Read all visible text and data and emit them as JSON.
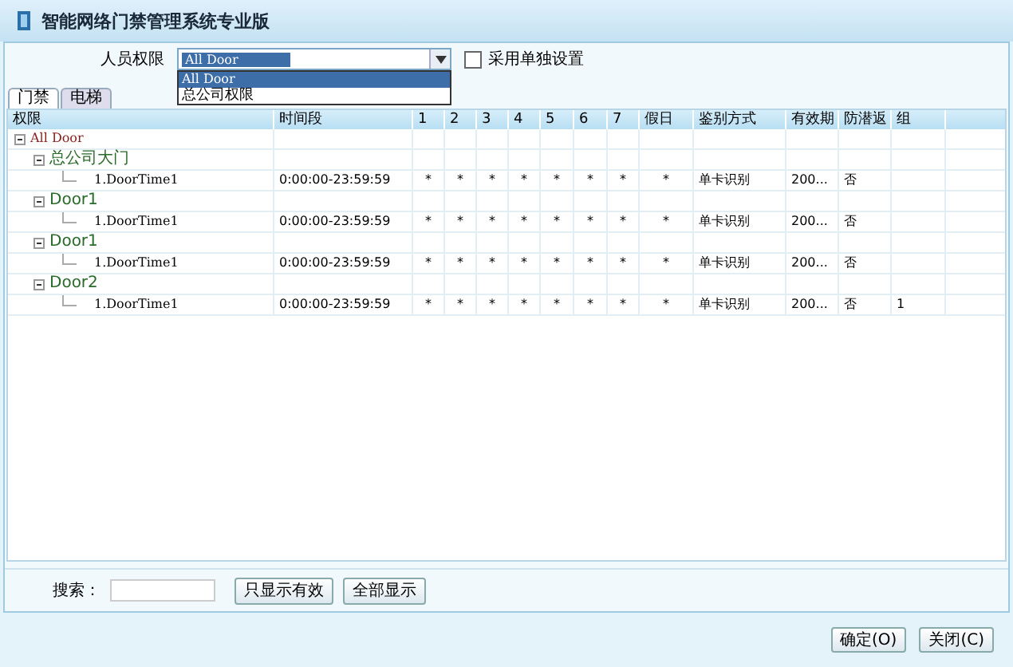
{
  "window": {
    "title": "智能网络门禁管理系统专业版"
  },
  "permission": {
    "label": "人员权限",
    "value": "All Door",
    "expanded": true,
    "options": [
      {
        "label": "All Door",
        "selected": true
      },
      {
        "label": "总公司权限",
        "selected": false
      }
    ]
  },
  "separate": {
    "label": "采用单独设置",
    "checked": false
  },
  "tabs": [
    {
      "label": "门禁",
      "selected": true
    },
    {
      "label": "电梯",
      "selected": false
    }
  ],
  "table": {
    "columns": [
      "权限",
      "时间段",
      "1",
      "2",
      "3",
      "4",
      "5",
      "6",
      "7",
      "假日",
      "鉴别方式",
      "有效期",
      "防潜返",
      "组"
    ],
    "tree": [
      {
        "kind": "group",
        "name": "All Door",
        "expanded": true,
        "children": [
          {
            "kind": "group",
            "name": "总公司大门",
            "expanded": true,
            "children": [
              {
                "kind": "leaf",
                "cells": [
                  "1.DoorTime1",
                  "0:00:00-23:59:59",
                  "*",
                  "*",
                  "*",
                  "*",
                  "*",
                  "*",
                  "*",
                  "*",
                  "单卡识别",
                  "200...",
                  "否",
                  ""
                ]
              }
            ]
          },
          {
            "kind": "group",
            "name": "Door1",
            "expanded": true,
            "children": [
              {
                "kind": "leaf",
                "cells": [
                  "1.DoorTime1",
                  "0:00:00-23:59:59",
                  "*",
                  "*",
                  "*",
                  "*",
                  "*",
                  "*",
                  "*",
                  "*",
                  "单卡识别",
                  "200...",
                  "否",
                  ""
                ]
              }
            ]
          },
          {
            "kind": "group",
            "name": "Door1",
            "expanded": true,
            "children": [
              {
                "kind": "leaf",
                "cells": [
                  "1.DoorTime1",
                  "0:00:00-23:59:59",
                  "*",
                  "*",
                  "*",
                  "*",
                  "*",
                  "*",
                  "*",
                  "*",
                  "单卡识别",
                  "200...",
                  "否",
                  ""
                ]
              }
            ]
          },
          {
            "kind": "group",
            "name": "Door2",
            "expanded": true,
            "children": [
              {
                "kind": "leaf",
                "cells": [
                  "1.DoorTime1",
                  "0:00:00-23:59:59",
                  "*",
                  "*",
                  "*",
                  "*",
                  "*",
                  "*",
                  "*",
                  "*",
                  "单卡识别",
                  "200...",
                  "否",
                  "1"
                ]
              }
            ]
          }
        ]
      }
    ]
  },
  "search": {
    "label": "搜索："
  },
  "filter_buttons": [
    "只显示有效",
    "全部显示"
  ],
  "buttons": [
    "确定(O)",
    "关闭(C)"
  ]
}
